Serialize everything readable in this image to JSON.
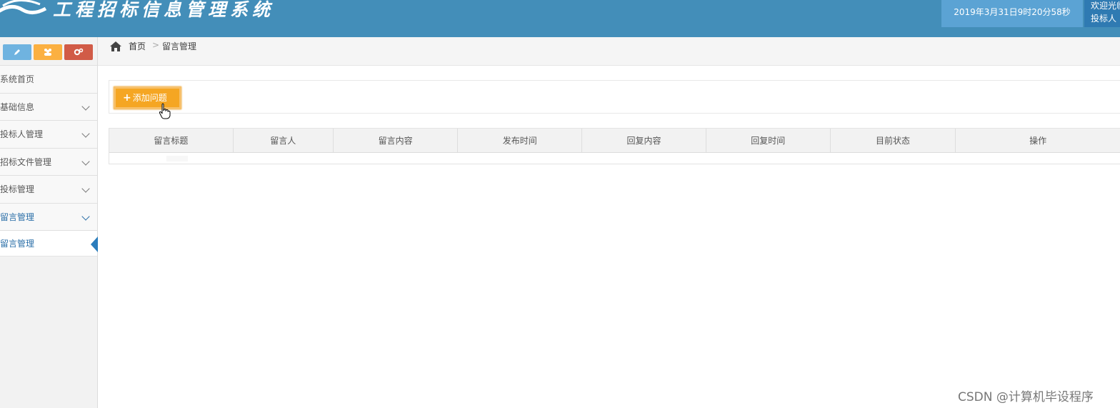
{
  "header": {
    "app_title": "工程招标信息管理系统",
    "clock": "2019年3月31日9时20分58秒",
    "welcome": "欢迎光临",
    "user_role": "投标人"
  },
  "sidebar": {
    "items": [
      {
        "label": "系统首页"
      },
      {
        "label": "基础信息"
      },
      {
        "label": "投标人管理"
      },
      {
        "label": "招标文件管理"
      },
      {
        "label": "投标管理"
      },
      {
        "label": "留言管理"
      }
    ],
    "active_sub": "留言管理"
  },
  "breadcrumb": {
    "home": "首页",
    "separator": ">",
    "current": "留言管理"
  },
  "toolbar": {
    "add_label": "添加问题"
  },
  "table": {
    "columns": [
      "留言标题",
      "留言人",
      "留言内容",
      "发布时间",
      "回复内容",
      "回复时间",
      "目前状态",
      "操作"
    ]
  },
  "watermark": "CSDN @计算机毕设程序",
  "colors": {
    "header_bg": "#438eb9",
    "clock_bg": "#5ba3d4",
    "add_button": "#f5a623",
    "active_nav": "#2b6fa8"
  },
  "icons": [
    "pencil-icon",
    "users-icon",
    "cogs-icon",
    "home-icon",
    "chevron-down-icon",
    "hand-cursor-icon"
  ]
}
